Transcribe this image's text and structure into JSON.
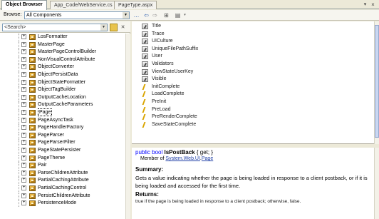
{
  "tabs": [
    {
      "label": "Object Browser",
      "active": true
    },
    {
      "label": "App_Code/WebService.cs",
      "active": false
    },
    {
      "label": "PageType.aspx",
      "active": false
    }
  ],
  "toolbar": {
    "browse_label": "Browse:",
    "browse_value": "All Components",
    "back_icon": "back-arrow-icon",
    "forward_icon": "forward-arrow-icon"
  },
  "search": {
    "placeholder": "<Search>"
  },
  "tree": {
    "items": [
      {
        "label": "LosFormatter"
      },
      {
        "label": "MasterPage"
      },
      {
        "label": "MasterPageControlBuilder"
      },
      {
        "label": "NonVisualControlAttribute"
      },
      {
        "label": "ObjectConverter"
      },
      {
        "label": "ObjectPersistData"
      },
      {
        "label": "ObjectStateFormatter"
      },
      {
        "label": "ObjectTagBuilder"
      },
      {
        "label": "OutputCacheLocation"
      },
      {
        "label": "OutputCacheParameters"
      },
      {
        "label": "Page",
        "selected": true
      },
      {
        "label": "PageAsyncTask"
      },
      {
        "label": "PageHandlerFactory"
      },
      {
        "label": "PageParser"
      },
      {
        "label": "PageParserFilter"
      },
      {
        "label": "PageStatePersister"
      },
      {
        "label": "PageTheme"
      },
      {
        "label": "Pair"
      },
      {
        "label": "ParseChildrenAttribute"
      },
      {
        "label": "PartialCachingAttribute"
      },
      {
        "label": "PartialCachingControl"
      },
      {
        "label": "PersistChildrenAttribute"
      },
      {
        "label": "PersistenceMode"
      }
    ]
  },
  "members": {
    "items": [
      {
        "label": "Title",
        "kind": "property"
      },
      {
        "label": "Trace",
        "kind": "property"
      },
      {
        "label": "UICulture",
        "kind": "property"
      },
      {
        "label": "UniqueFilePathSuffix",
        "kind": "property"
      },
      {
        "label": "User",
        "kind": "property"
      },
      {
        "label": "Validators",
        "kind": "property"
      },
      {
        "label": "ViewStateUserKey",
        "kind": "property"
      },
      {
        "label": "Visible",
        "kind": "property"
      },
      {
        "label": "InitComplete",
        "kind": "event"
      },
      {
        "label": "LoadComplete",
        "kind": "event"
      },
      {
        "label": "PreInit",
        "kind": "event"
      },
      {
        "label": "PreLoad",
        "kind": "event"
      },
      {
        "label": "PreRenderComplete",
        "kind": "event"
      },
      {
        "label": "SaveStateComplete",
        "kind": "event"
      }
    ]
  },
  "description": {
    "sig_public": "public",
    "sig_type": "bool",
    "sig_name": "IsPostBack",
    "sig_rest": "{ get; }",
    "member_of_label": "Member of",
    "member_of_ns": "System.Web.UI",
    "member_of_class": "Page",
    "summary_heading": "Summary:",
    "summary_text": "Gets a value indicating whether the page is being loaded in response to a client postback, or if it is being loaded and accessed for the first time.",
    "returns_heading": "Returns:",
    "returns_text": "true if the page is being loaded in response to a client postback; otherwise, false."
  }
}
